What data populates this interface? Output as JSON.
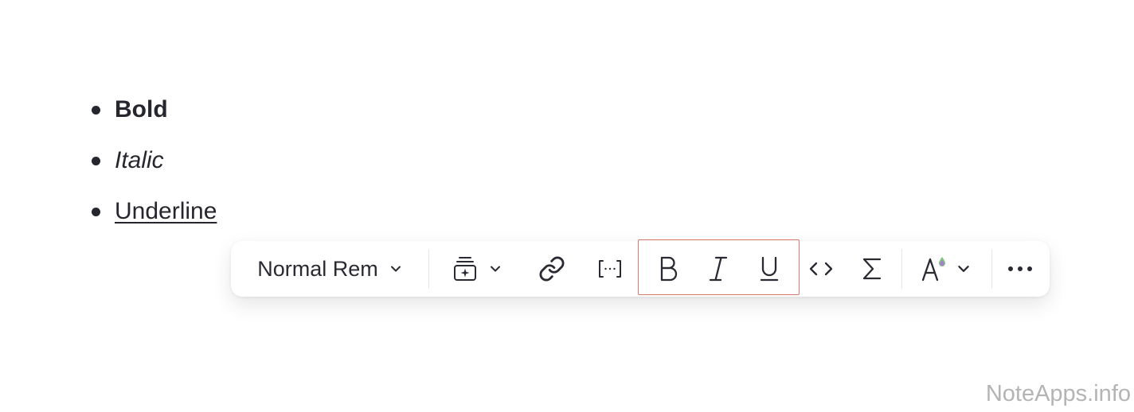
{
  "list": {
    "items": [
      {
        "label": "Bold"
      },
      {
        "label": "Italic"
      },
      {
        "label": "Underline"
      }
    ]
  },
  "toolbar": {
    "style_dropdown": {
      "label": "Normal Rem"
    },
    "buttons": [
      {
        "icon": "block-insert-icon"
      },
      {
        "icon": "link-icon"
      },
      {
        "icon": "inline-reference-icon"
      },
      {
        "icon": "bold-icon"
      },
      {
        "icon": "italic-icon"
      },
      {
        "icon": "underline-icon"
      },
      {
        "icon": "code-icon"
      },
      {
        "icon": "sigma-icon"
      },
      {
        "icon": "text-color-icon"
      },
      {
        "icon": "more-icon"
      }
    ],
    "highlight_color": "#d9796f",
    "highlighted_group": [
      "bold-icon",
      "italic-icon",
      "underline-icon"
    ]
  },
  "watermark": {
    "text": "NoteApps.info"
  }
}
